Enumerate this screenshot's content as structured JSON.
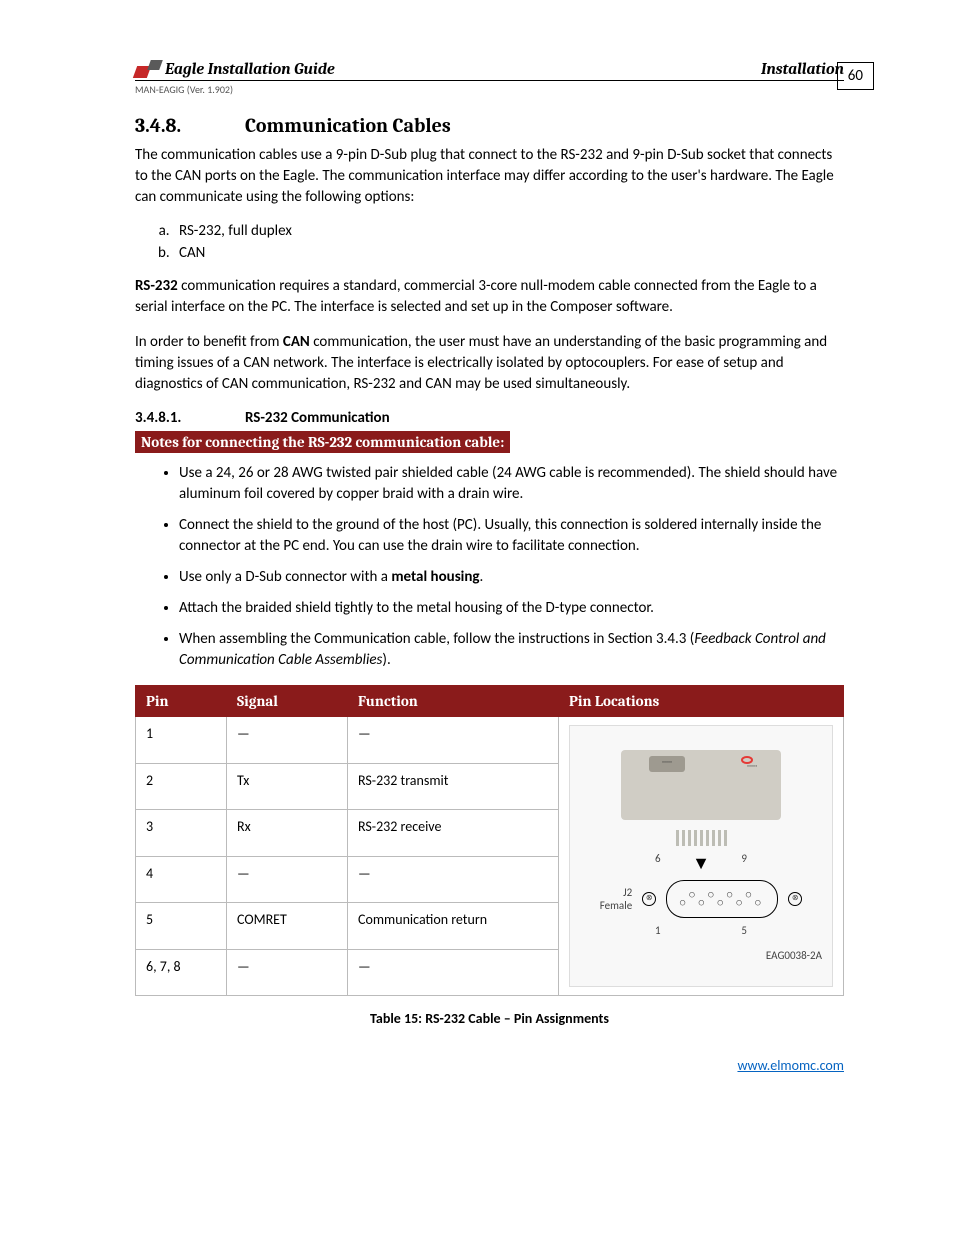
{
  "header": {
    "title": "Eagle Installation Guide",
    "section": "Installation",
    "docid": "MAN-EAGIG (Ver. 1.902)",
    "page": "60"
  },
  "h1": {
    "num": "3.4.8.",
    "title": "Communication Cables"
  },
  "p1": "The communication cables use a 9-pin D-Sub plug that connect to the RS-232 and 9-pin D-Sub socket that connects to the CAN ports on the Eagle. The communication interface may differ according to the user's hardware. The Eagle can communicate using the following options:",
  "list_ab": [
    "RS-232, full duplex",
    "CAN"
  ],
  "p2_a": "RS-232",
  "p2_b": " communication requires a standard, commercial 3-core null-modem cable connected from the Eagle to a serial interface on the PC. The interface is selected and set up in the Composer software.",
  "p3_a": "In order to benefit from ",
  "p3_b": "CAN",
  "p3_c": " communication, the user must have an understanding of the basic programming and timing issues of a CAN network. The interface is electrically isolated by optocouplers. For ease of setup and diagnostics of CAN communication, RS-232 and CAN may be used simultaneously.",
  "h2": {
    "num": "3.4.8.1.",
    "title": "RS-232 Communication"
  },
  "banner": "Notes for connecting the RS-232 communication cable:",
  "bullets": [
    "Use a 24, 26 or 28 AWG twisted pair shielded cable (24 AWG cable is recommended). The shield should have aluminum foil covered by copper braid with a drain wire.",
    "Connect the shield to the ground of the host (PC). Usually, this connection is soldered internally inside the connector at the PC end. You can use the drain wire to facilitate connection."
  ],
  "bullet3_a": "Use only a D-Sub connector with a ",
  "bullet3_b": "metal housing",
  "bullet3_c": ".",
  "bullet4": "Attach the braided shield tightly to the metal housing of the D-type connector.",
  "bullet5_a": "When assembling the Communication cable, follow the instructions in Section 3.4.3 (",
  "bullet5_b": "Feedback Control and Communication Cable Assemblies",
  "bullet5_c": ").",
  "table": {
    "headers": [
      "Pin",
      "Signal",
      "Function",
      "Pin Locations"
    ],
    "rows": [
      {
        "pin": "1",
        "signal": "—",
        "func": "—"
      },
      {
        "pin": "2",
        "signal": "Tx",
        "func": "RS-232 transmit"
      },
      {
        "pin": "3",
        "signal": "Rx",
        "func": "RS-232 receive"
      },
      {
        "pin": "4",
        "signal": "—",
        "func": "—"
      },
      {
        "pin": "5",
        "signal": "COMRET",
        "func": "Communication return"
      },
      {
        "pin": "6, 7, 8",
        "signal": "—",
        "func": "—"
      }
    ]
  },
  "pinloc": {
    "j2": "J2",
    "female": "Female",
    "p6": "6",
    "p9": "9",
    "p1": "1",
    "p5": "5",
    "code": "EAG0038-2A"
  },
  "caption": "Table 15: RS-232 Cable – Pin Assignments",
  "footer_url": "www.elmomc.com"
}
